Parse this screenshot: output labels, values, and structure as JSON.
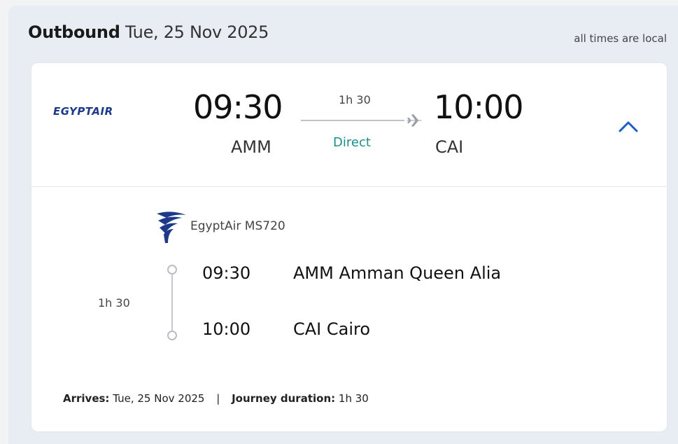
{
  "header": {
    "title_bold": "Outbound",
    "title_date": "Tue, 25 Nov 2025",
    "note": "all times are local"
  },
  "summary": {
    "airline_logo_text": "EGYPTAIR",
    "departure_time": "09:30",
    "departure_code": "AMM",
    "arrival_time": "10:00",
    "arrival_code": "CAI",
    "duration": "1h 30",
    "stops": "Direct"
  },
  "segment": {
    "airline_flight": "EgyptAir MS720",
    "duration": "1h 30",
    "departure_time": "09:30",
    "departure_place": "AMM Amman Queen Alia",
    "arrival_time": "10:00",
    "arrival_place": "CAI Cairo"
  },
  "footer": {
    "arrives_label": "Arrives:",
    "arrives_value": "Tue, 25 Nov 2025",
    "separator": "|",
    "journey_label": "Journey duration:",
    "journey_value": "1h 30"
  },
  "colors": {
    "accent": "#1d5ec8",
    "direct": "#1a8f87",
    "airline_blue": "#1d3a8a"
  }
}
